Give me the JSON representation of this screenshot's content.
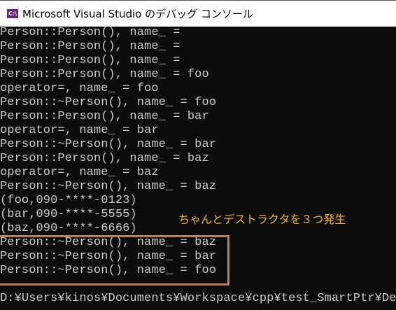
{
  "window": {
    "title": "Microsoft Visual Studio のデバッグ コンソール",
    "icon": "C:\\"
  },
  "console_lines": [
    "Person::Person(), name_ =",
    "Person::Person(), name_ =",
    "Person::Person(), name_ =",
    "Person::Person(), name_ = foo",
    "operator=, name_ = foo",
    "Person::~Person(), name_ = foo",
    "Person::Person(), name_ = bar",
    "operator=, name_ = bar",
    "Person::~Person(), name_ = bar",
    "Person::Person(), name_ = baz",
    "operator=, name_ = baz",
    "Person::~Person(), name_ = baz",
    "(foo,090-****-0123)",
    "(bar,090-****-5555)",
    "(baz,090-****-6666)",
    "Person::~Person(), name_ = baz",
    "Person::~Person(), name_ = bar",
    "Person::~Person(), name_ = foo",
    "",
    "D:¥Users¥kinos¥Documents¥Workspace¥cpp¥test_SmartPtr¥Debu"
  ],
  "annotation": "ちゃんとデストラクタを３つ発生",
  "colors": {
    "highlight_box": "#b9825f",
    "annotation": "#f2b51a"
  }
}
